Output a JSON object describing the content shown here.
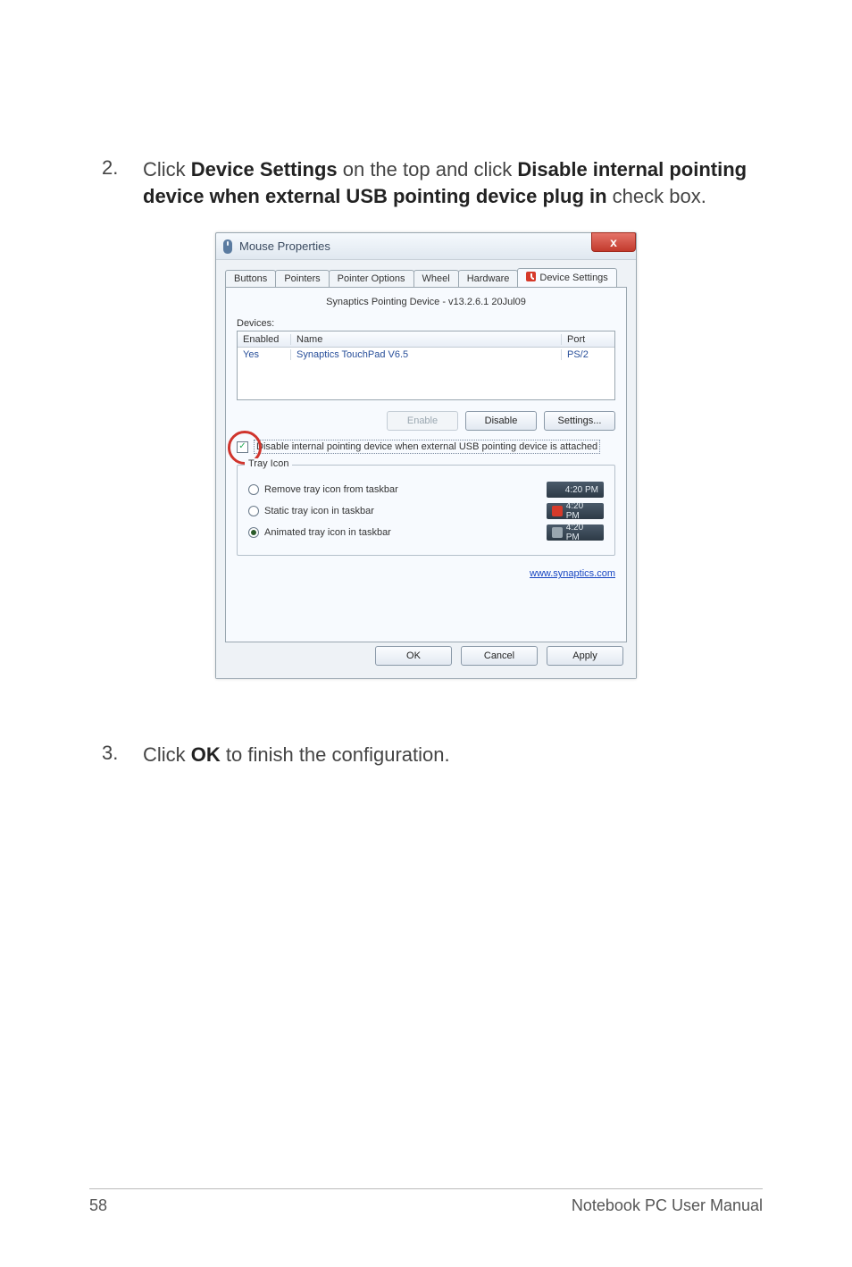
{
  "steps": {
    "s2": {
      "num": "2.",
      "pre": "Click ",
      "bold1": "Device Settings",
      "mid1": " on the top and click ",
      "bold2": "Disable internal pointing device when external USB pointing device plug in",
      "post": " check box."
    },
    "s3": {
      "num": "3.",
      "pre": "Click ",
      "bold1": "OK",
      "post": " to finish the configuration."
    }
  },
  "dialog": {
    "title": "Mouse Properties",
    "close": "x",
    "tabs": {
      "t1": "Buttons",
      "t2": "Pointers",
      "t3": "Pointer Options",
      "t4": "Wheel",
      "t5": "Hardware",
      "t6": "Device Settings"
    },
    "subtitle": "Synaptics Pointing Device - v13.2.6.1 20Jul09",
    "devices_label": "Devices:",
    "head": {
      "c1": "Enabled",
      "c2": "Name",
      "c3": "Port"
    },
    "row": {
      "c1": "Yes",
      "c2": "Synaptics TouchPad V6.5",
      "c3": "PS/2"
    },
    "btns": {
      "enable": "Enable",
      "disable": "Disable",
      "settings": "Settings..."
    },
    "checkbox_label": "Disable internal pointing device when external USB pointing device is attached",
    "checkbox_mark": "✓",
    "tray": {
      "title": "Tray Icon",
      "opt1": "Remove tray icon from taskbar",
      "opt2": "Static tray icon in taskbar",
      "opt3": "Animated tray icon in taskbar",
      "time": "4:20 PM"
    },
    "link": "www.synaptics.com",
    "bottom": {
      "ok": "OK",
      "cancel": "Cancel",
      "apply": "Apply"
    }
  },
  "footer": {
    "page": "58",
    "right": "Notebook PC User Manual"
  }
}
